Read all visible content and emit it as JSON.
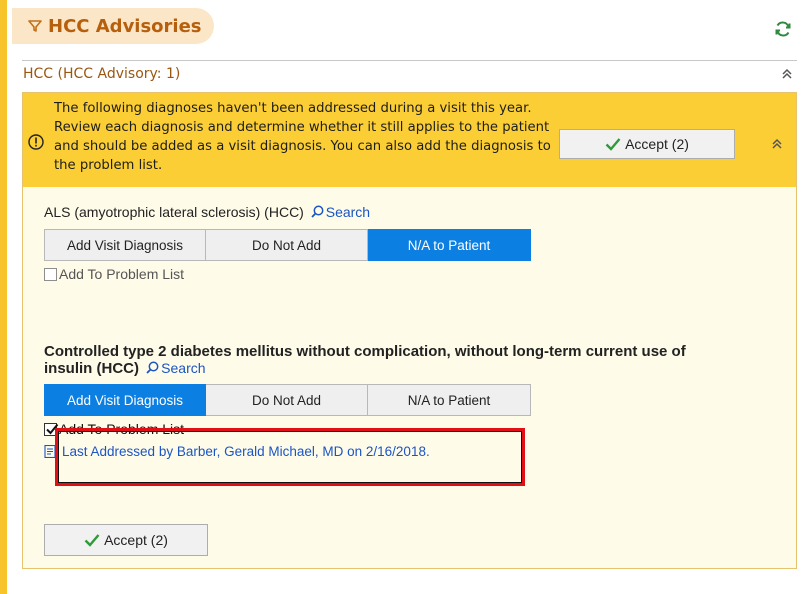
{
  "header": {
    "title": "HCC Advisories",
    "icons": [
      "filter-icon",
      "refresh-icon"
    ]
  },
  "section": {
    "title": "HCC (HCC Advisory: 1)"
  },
  "alert": {
    "text": "The following diagnoses haven't been addressed during a visit this year. Review each diagnosis and determine whether it still applies to the patient and should be added as a visit diagnosis. You can also add the diagnosis to the problem list.",
    "accept_label": "Accept (2)"
  },
  "diagnoses": [
    {
      "title": "ALS (amyotrophic lateral sclerosis) (HCC)",
      "search_label": "Search",
      "options": [
        "Add Visit Diagnosis",
        "Do Not Add",
        "N/A to Patient"
      ],
      "selected": "N/A to Patient",
      "problem_list_label": "Add To Problem List",
      "problem_list_checked": false
    },
    {
      "title": "Controlled type 2 diabetes mellitus without complication, without long-term current use of insulin (HCC)",
      "search_label": "Search",
      "options": [
        "Add Visit Diagnosis",
        "Do Not Add",
        "N/A to Patient"
      ],
      "selected": "Add Visit Diagnosis",
      "problem_list_label": "Add To Problem List",
      "problem_list_checked": true,
      "last_addressed": "Last Addressed by Barber, Gerald Michael, MD on 2/16/2018."
    }
  ],
  "footer": {
    "accept_label": "Accept (2)"
  },
  "colors": {
    "accent": "#f7c42b",
    "alert_bg": "#fcce35",
    "selected": "#0c7fe2",
    "highlight": "#e10f16",
    "link": "#1b55c4"
  }
}
